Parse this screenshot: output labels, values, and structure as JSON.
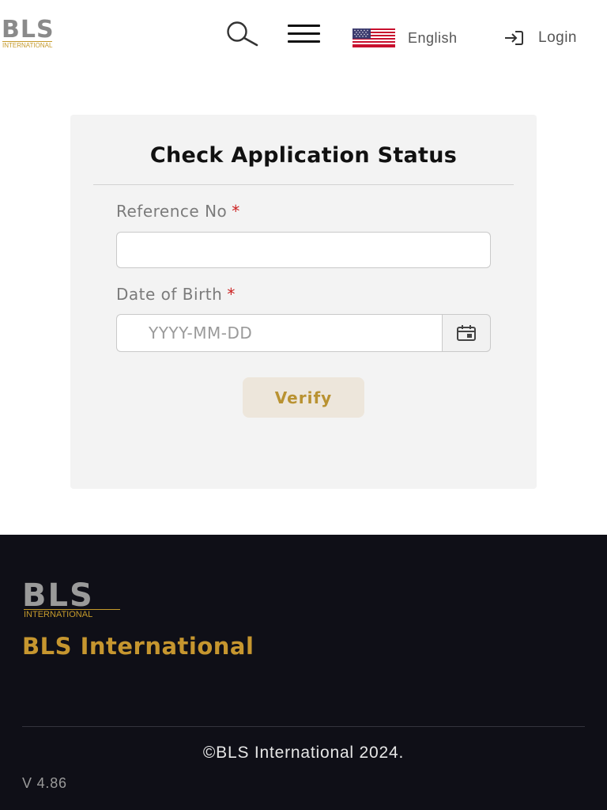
{
  "header": {
    "logo_text": "BLS",
    "logo_subtext": "INTERNATIONAL",
    "search_icon": "search-icon",
    "menu_icon": "hamburger-menu-icon",
    "language": {
      "flag_icon": "us-flag-icon",
      "label": "English"
    },
    "login": {
      "icon": "login-icon",
      "label": "Login"
    }
  },
  "card": {
    "title": "Check Application Status",
    "reference": {
      "label": "Reference No",
      "required_mark": "*",
      "value": "",
      "placeholder": ""
    },
    "dob": {
      "label": "Date of Birth",
      "required_mark": "*",
      "value": "",
      "placeholder": "YYYY-MM-DD",
      "calendar_icon": "calendar-icon"
    },
    "verify_label": "Verify"
  },
  "footer": {
    "logo_text": "BLS",
    "logo_subtext": "INTERNATIONAL",
    "brand": "BLS International",
    "copyright": "©BLS International 2024.",
    "version": "V 4.86"
  },
  "colors": {
    "accent_gold": "#c6962f",
    "footer_bg": "#0f0f17",
    "card_bg": "#f3f3f3",
    "verify_bg": "#ede6db",
    "required_red": "#cc2020"
  }
}
